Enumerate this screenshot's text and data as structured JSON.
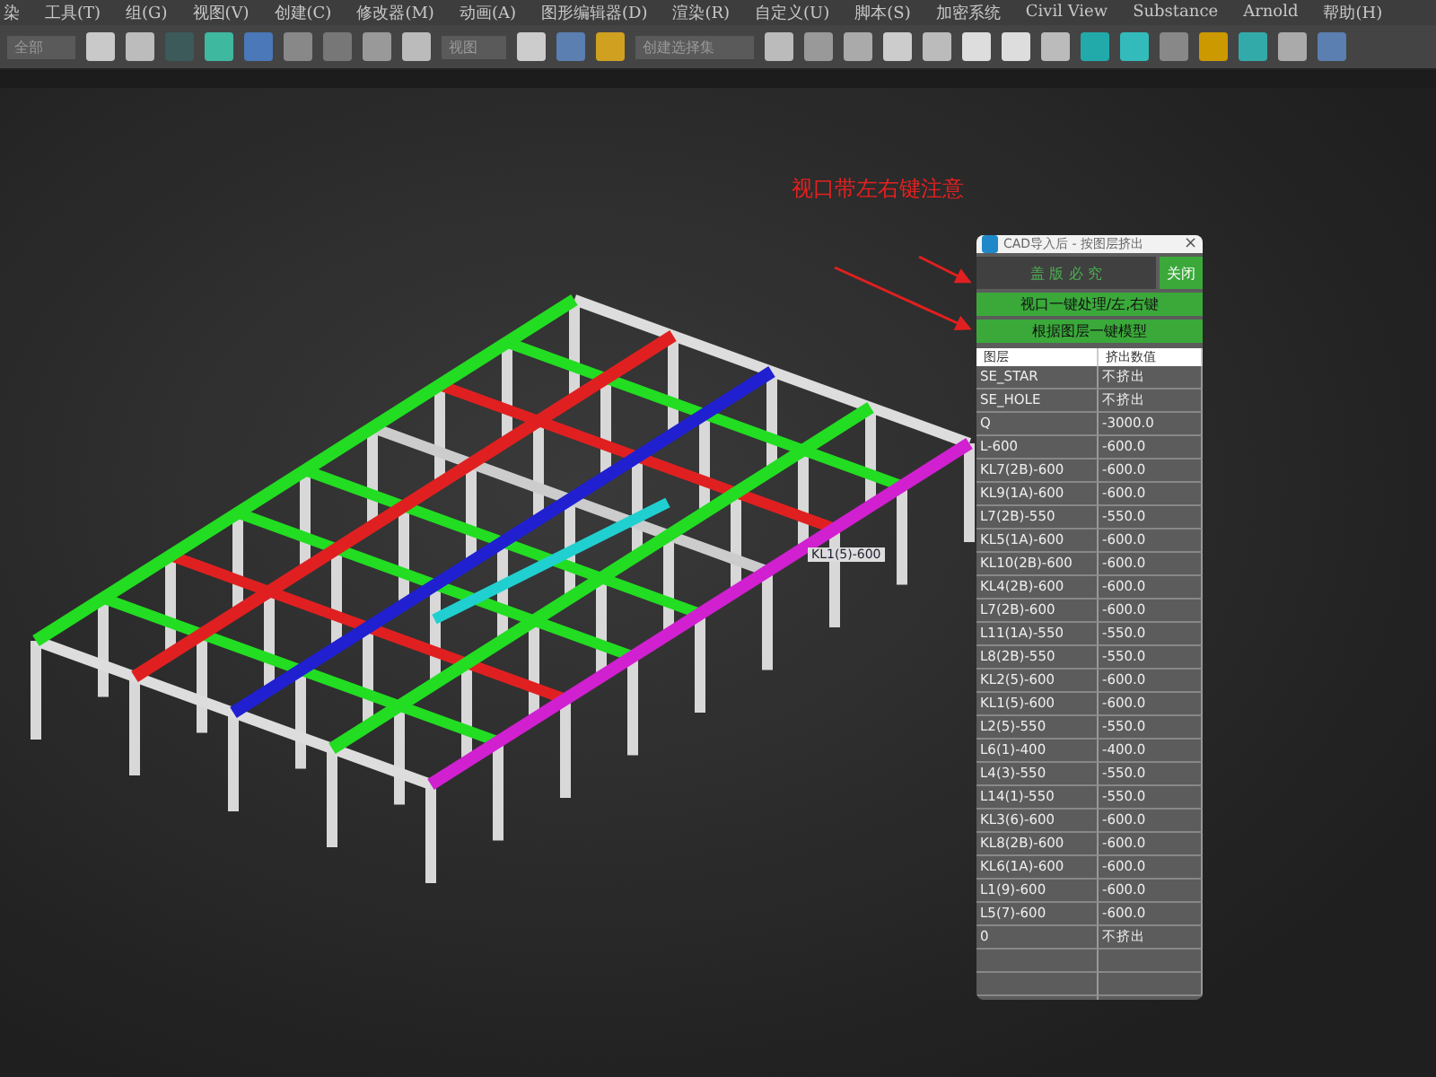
{
  "menu": [
    "染",
    "工具(T)",
    "组(G)",
    "视图(V)",
    "创建(C)",
    "修改器(M)",
    "动画(A)",
    "图形编辑器(D)",
    "渲染(R)",
    "自定义(U)",
    "脚本(S)",
    "加密系统",
    "Civil View",
    "Substance",
    "Arnold",
    "帮助(H)"
  ],
  "toolbar": {
    "selection_filter": "全部",
    "reference_coord": "视图",
    "named_selection": "创建选择集"
  },
  "viewport": {
    "annotation": "视口带左右键注意",
    "object_label": "KL1(5)-600"
  },
  "panel": {
    "title": "CAD导入后 - 按图层挤出",
    "close": "×",
    "buttons": [
      {
        "label": "盖 版 必 究",
        "kind": "dark"
      },
      {
        "label": "关闭",
        "kind": "light"
      }
    ],
    "actions": [
      "视口一键处理/左,右键",
      "根据图层一键模型"
    ],
    "columns": [
      "图层",
      "挤出数值"
    ],
    "rows": [
      [
        "SE_STAR",
        "不挤出"
      ],
      [
        "SE_HOLE",
        "不挤出"
      ],
      [
        "Q",
        "-3000.0"
      ],
      [
        "L-600",
        "-600.0"
      ],
      [
        "KL7(2B)-600",
        "-600.0"
      ],
      [
        "KL9(1A)-600",
        "-600.0"
      ],
      [
        "L7(2B)-550",
        "-550.0"
      ],
      [
        "KL5(1A)-600",
        "-600.0"
      ],
      [
        "KL10(2B)-600",
        "-600.0"
      ],
      [
        "KL4(2B)-600",
        "-600.0"
      ],
      [
        "L7(2B)-600",
        "-600.0"
      ],
      [
        "L11(1A)-550",
        "-550.0"
      ],
      [
        "L8(2B)-550",
        "-550.0"
      ],
      [
        "KL2(5)-600",
        "-600.0"
      ],
      [
        "KL1(5)-600",
        "-600.0"
      ],
      [
        "L2(5)-550",
        "-550.0"
      ],
      [
        "L6(1)-400",
        "-400.0"
      ],
      [
        "L4(3)-550",
        "-550.0"
      ],
      [
        "L14(1)-550",
        "-550.0"
      ],
      [
        "KL3(6)-600",
        "-600.0"
      ],
      [
        "KL8(2B)-600",
        "-600.0"
      ],
      [
        "KL6(1A)-600",
        "-600.0"
      ],
      [
        "L1(9)-600",
        "-600.0"
      ],
      [
        "L5(7)-600",
        "-600.0"
      ],
      [
        "0",
        "不挤出"
      ]
    ]
  }
}
